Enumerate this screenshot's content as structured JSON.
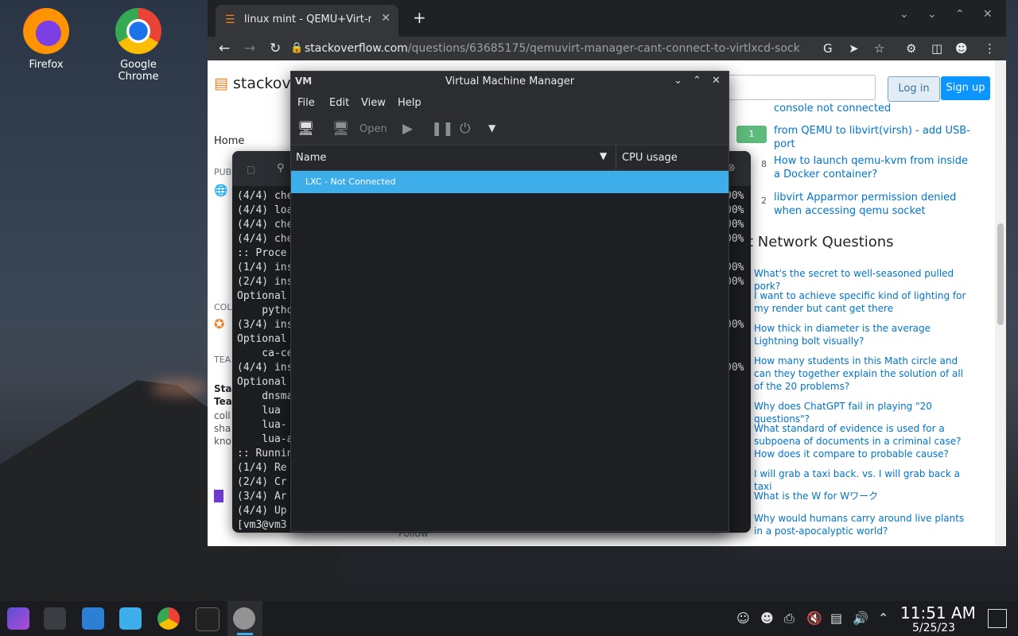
{
  "desktop": {
    "icons": [
      {
        "label": "Firefox"
      },
      {
        "label": "Google Chrome"
      }
    ]
  },
  "browser": {
    "tab_title": "linux mint - QEMU+Virt-mana",
    "url_domain": "stackoverflow.com",
    "url_path": "/questions/63685175/qemuvirt-manager-cant-connect-to-virtlxcd-sock",
    "page": {
      "login": "Log in",
      "signup": "Sign up",
      "nav_home": "Home",
      "nav_public": "PUBL",
      "nav_collectives": "COL",
      "nav_teams": "TEA",
      "teams_text": [
        "Sta",
        "Tea",
        "coll",
        "sha",
        "kno"
      ],
      "related": [
        {
          "votes": "",
          "text": "console not connected"
        },
        {
          "votes": "1",
          "text": "from QEMU to libvirt(virsh) - add USB-port"
        },
        {
          "votes": "8",
          "text": "How to launch qemu-kvm from inside a Docker container?"
        },
        {
          "votes": "2",
          "text": "libvirt Apparmor permission denied when accessing qemu socket"
        }
      ],
      "hnq_title": "ot Network Questions",
      "hnq": [
        "What's the secret to well-seasoned pulled pork?",
        "I want to achieve specific kind of lighting for my render but cant get there",
        "How thick in diameter is the average Lightning bolt visually?",
        "How many students in this Math circle and can they together explain the solution of all of the 20 problems?",
        "Why does ChatGPT fail in playing \"20 questions\"?",
        "What standard of evidence is used for a subpoena of documents in a criminal case? How does it compare to probable cause?",
        "I will grab a taxi back. vs. I will grab back a taxi",
        "What is the W for Wワーク",
        "Why would humans carry around live plants in a post-apocalyptic world?"
      ],
      "follow": "Follow"
    }
  },
  "terminal": {
    "lines": [
      "(4/4) che",
      "(4/4) loa",
      "(4/4) che",
      "(4/4) che",
      ":: Proce",
      "(1/4) ins",
      "(2/4) ins",
      "Optional",
      "    pytho",
      "(3/4) ins",
      "Optional",
      "    ca-ce",
      "(4/4) ins",
      "Optional",
      "    dnsma",
      "    lua ",
      "    lua-",
      "    lua-a",
      ":: Runnin",
      "(1/4) Re",
      "(2/4) Cr",
      "(3/4) Ar",
      "(4/4) Up",
      "[vm3@vm3"
    ],
    "right": [
      "00%",
      "00%",
      "00%",
      "00%",
      "",
      "00%",
      "00%",
      "",
      "",
      "00%",
      "",
      "",
      "00%"
    ]
  },
  "vmm": {
    "title": "Virtual Machine Manager",
    "logo": "VM",
    "menu": [
      "File",
      "Edit",
      "View",
      "Help"
    ],
    "toolbar_open": "Open",
    "col_name": "Name",
    "col_cpu": "CPU usage",
    "rows": [
      {
        "name": "LXC - Not Connected"
      }
    ]
  },
  "taskbar": {
    "time": "11:51 AM",
    "date": "5/25/23"
  }
}
